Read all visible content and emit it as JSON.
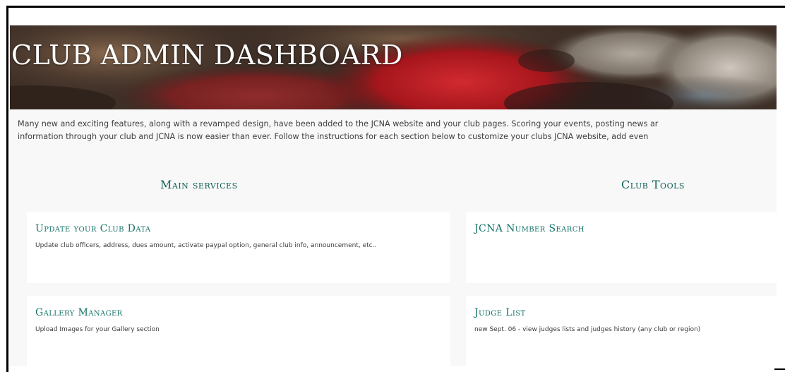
{
  "page": {
    "title": "CLUB ADMIN DASHBOARD",
    "intro_line1": "Many new and exciting features, along with a revamped design, have been added to the JCNA website and your club pages. Scoring your events, posting news ar",
    "intro_line2": "information through your club and JCNA is now easier than ever. Follow the instructions for each section below to customize your clubs JCNA website, add even"
  },
  "main_services": {
    "heading": "Main services",
    "cards": [
      {
        "title": "Update your Club Data",
        "description": "Update club officers, address, dues amount, activate paypal option, general club info, announcement, etc.."
      },
      {
        "title": "Gallery Manager",
        "description": "Upload Images for your Gallery section"
      }
    ]
  },
  "club_tools": {
    "heading": "Club Tools",
    "cards": [
      {
        "title": "JCNA Number Search",
        "description": ""
      },
      {
        "title": "Judge List",
        "description": "new Sept. 06 - view judges lists and judges history (any club or region)"
      }
    ]
  },
  "colors": {
    "accent": "#137368",
    "heading": "#0e5f57",
    "page_bg": "#f7f8f7",
    "card_bg": "#ffffff"
  }
}
